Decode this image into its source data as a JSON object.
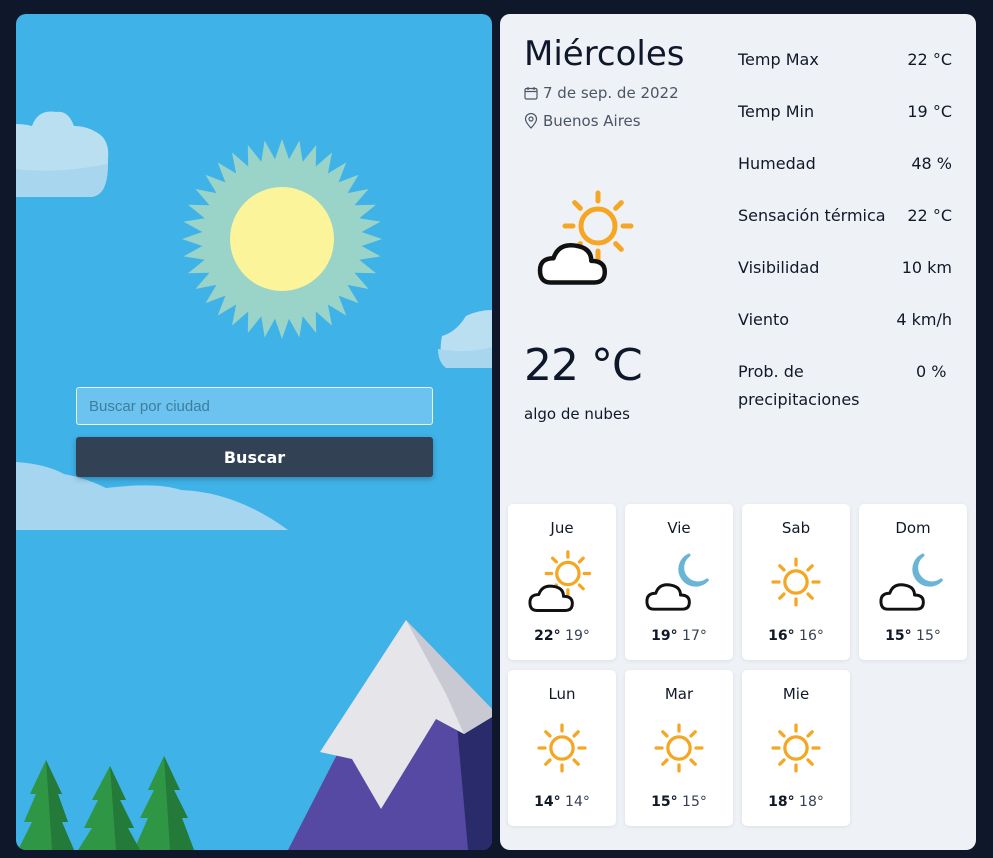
{
  "search": {
    "placeholder": "Buscar por ciudad",
    "value": "",
    "button_label": "Buscar"
  },
  "current": {
    "day": "Miércoles",
    "date": "7 de sep. de 2022",
    "city": "Buenos Aires",
    "temperature": "22 °C",
    "description": "algo de nubes",
    "icon": "sun-behind-cloud-icon"
  },
  "stats": [
    {
      "label": "Temp Max",
      "value": "22 °C"
    },
    {
      "label": "Temp Min",
      "value": "19 °C"
    },
    {
      "label": "Humedad",
      "value": "48 %"
    },
    {
      "label": "Sensación térmica",
      "value": "22 °C"
    },
    {
      "label": "Visibilidad",
      "value": "10 km"
    },
    {
      "label": "Viento",
      "value": "4 km/h"
    },
    {
      "label": "Prob. de precipitaciones",
      "value": "0 %"
    }
  ],
  "forecast": [
    {
      "day": "Jue",
      "max": "22°",
      "min": "19°",
      "icon": "sun-behind-cloud-icon"
    },
    {
      "day": "Vie",
      "max": "19°",
      "min": "17°",
      "icon": "moon-cloud-icon"
    },
    {
      "day": "Sab",
      "max": "16°",
      "min": "16°",
      "icon": "sun-icon"
    },
    {
      "day": "Dom",
      "max": "15°",
      "min": "15°",
      "icon": "moon-cloud-icon"
    },
    {
      "day": "Lun",
      "max": "14°",
      "min": "14°",
      "icon": "sun-icon"
    },
    {
      "day": "Mar",
      "max": "15°",
      "min": "15°",
      "icon": "sun-icon"
    },
    {
      "day": "Mie",
      "max": "18°",
      "min": "18°",
      "icon": "sun-icon"
    }
  ],
  "colors": {
    "page_bg": "#0f172a",
    "sky": "#3fb2e8",
    "panel_bg": "#eef2f7",
    "button_bg": "#334155",
    "sun_icon": "#f5a623",
    "moon_icon": "#6ab4d6"
  }
}
